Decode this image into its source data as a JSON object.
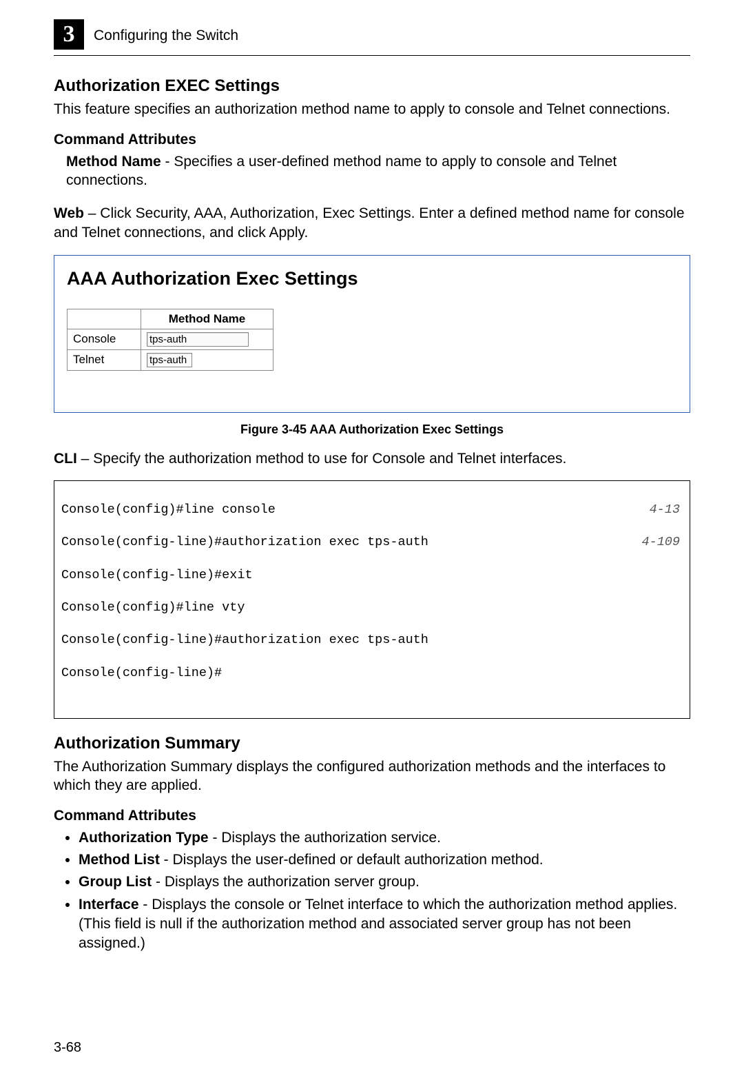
{
  "header": {
    "chapter_number": "3",
    "chapter_title": "Configuring the Switch"
  },
  "section1": {
    "title": "Authorization EXEC Settings",
    "intro": "This feature specifies an authorization method name to apply to console and Telnet connections.",
    "cmd_attr_heading": "Command Attributes",
    "method_name_label": "Method Name",
    "method_name_desc": " - Specifies a user-defined method name to apply to console and Telnet connections.",
    "web_label": "Web",
    "web_desc": " – Click Security, AAA, Authorization, Exec Settings. Enter a defined method name for console and Telnet connections, and click Apply."
  },
  "figure": {
    "panel_title": "AAA Authorization Exec Settings",
    "col_method": "Method Name",
    "rows": [
      {
        "label": "Console",
        "value": "tps-auth"
      },
      {
        "label": "Telnet",
        "value": "tps-auth"
      }
    ],
    "caption": "Figure 3-45  AAA Authorization Exec Settings"
  },
  "cli": {
    "label": "CLI",
    "desc": " – Specify the authorization method to use for Console and Telnet interfaces.",
    "lines": [
      {
        "text": "Console(config)#line console",
        "ref": "4-13"
      },
      {
        "text": "Console(config-line)#authorization exec tps-auth",
        "ref": "4-109"
      },
      {
        "text": "Console(config-line)#exit",
        "ref": ""
      },
      {
        "text": "Console(config)#line vty",
        "ref": ""
      },
      {
        "text": "Console(config-line)#authorization exec tps-auth",
        "ref": ""
      },
      {
        "text": "Console(config-line)#",
        "ref": ""
      }
    ]
  },
  "section2": {
    "title": "Authorization Summary",
    "intro": "The Authorization Summary displays the configured authorization methods and the interfaces to which they are applied.",
    "cmd_attr_heading": "Command Attributes",
    "bullets": [
      {
        "term": "Authorization Type",
        "desc": " - Displays the authorization service."
      },
      {
        "term": "Method List",
        "desc": " - Displays the user-defined or default authorization method."
      },
      {
        "term": "Group List",
        "desc": " - Displays the authorization server group."
      },
      {
        "term": "Interface",
        "desc": " - Displays the console or Telnet interface to which the authorization method applies. (This field is null if the authorization method and associated server group has not been assigned.)"
      }
    ]
  },
  "page_number": "3-68"
}
